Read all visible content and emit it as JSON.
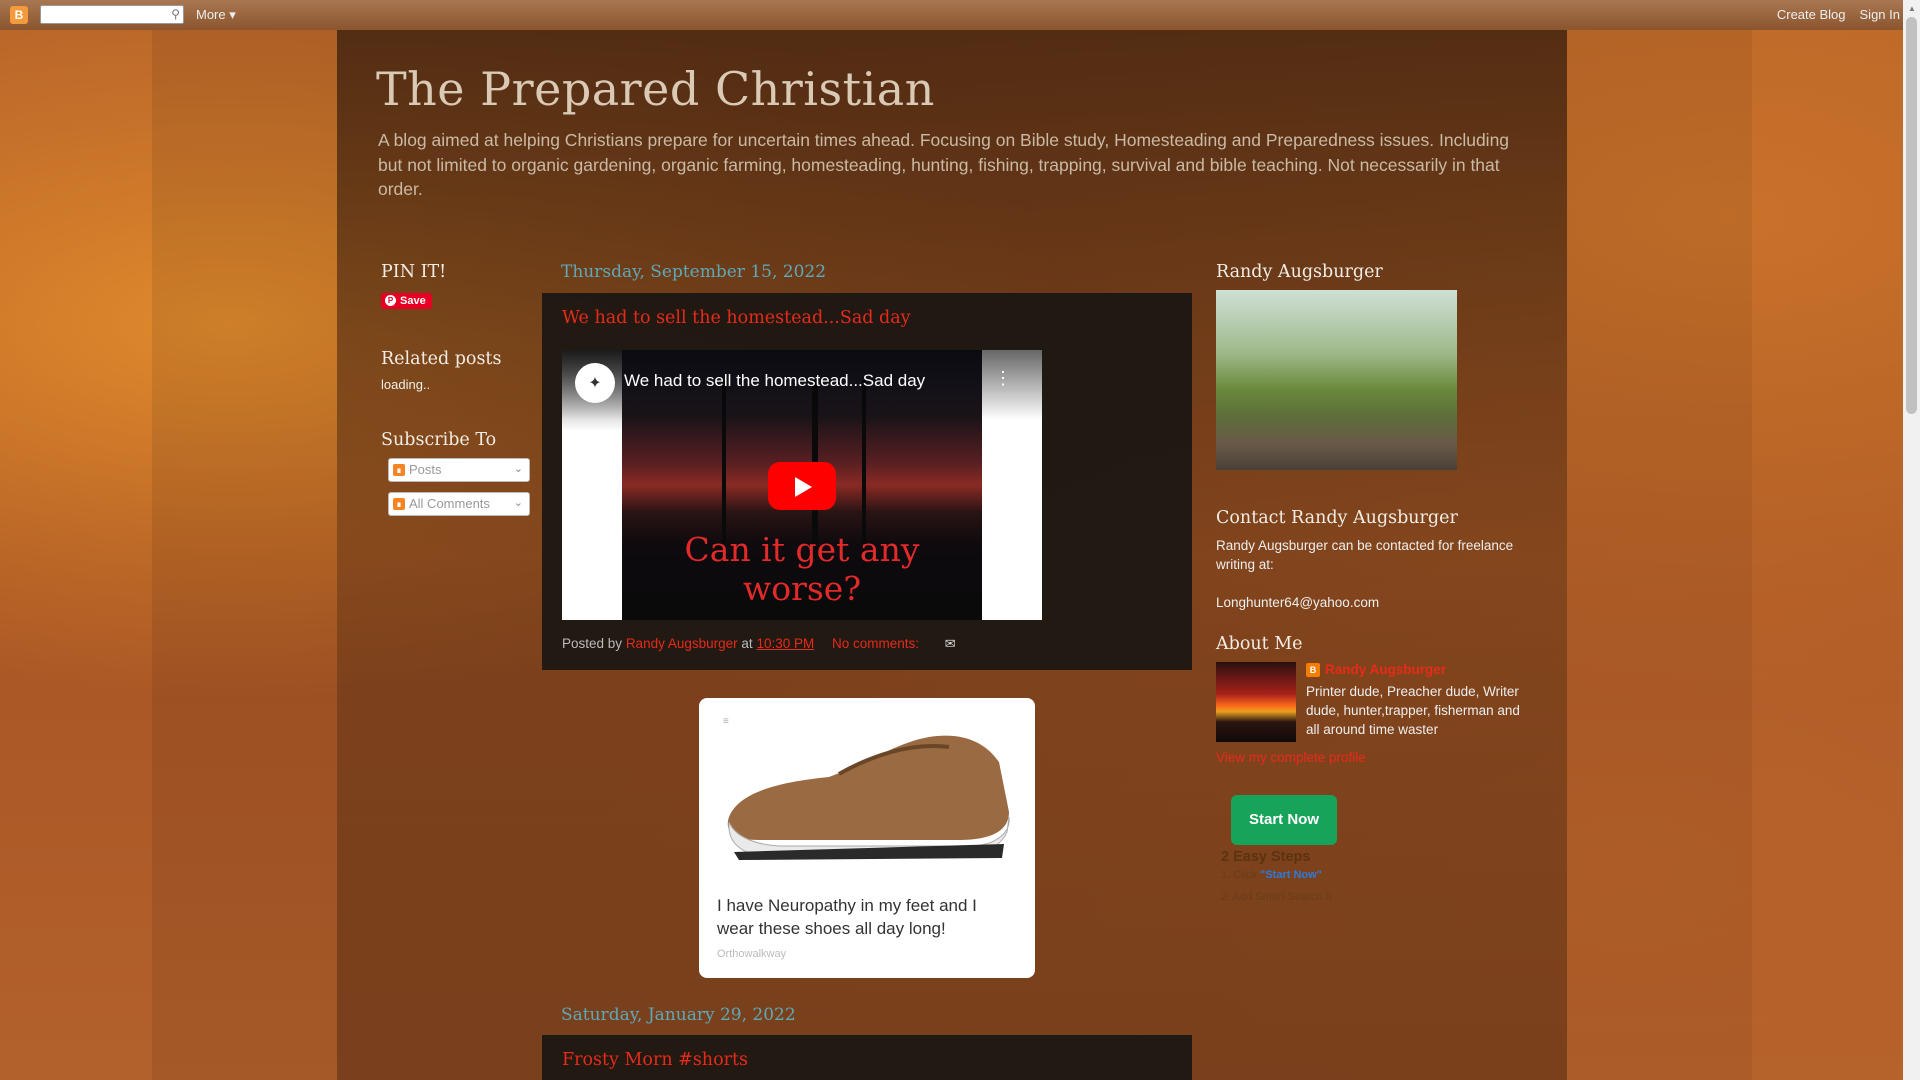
{
  "navbar": {
    "more_label": "More",
    "create_blog": "Create Blog",
    "sign_in": "Sign In"
  },
  "header": {
    "title": "The Prepared Christian",
    "description": "A blog aimed at helping Christians prepare for uncertain times ahead. Focusing on Bible study, Homesteading and Preparedness issues. Including but not limited to organic gardening, organic farming, homesteading, hunting, fishing, trapping, survival and bible teaching. Not necessarily in that order."
  },
  "left_sidebar": {
    "pin_title": "PIN IT!",
    "pin_button": "Save",
    "related_title": "Related posts",
    "related_loading": "loading..",
    "subscribe_title": "Subscribe To",
    "subscribe_posts": "Posts",
    "subscribe_comments": "All Comments"
  },
  "posts": [
    {
      "date": "Thursday, September 15, 2022",
      "title": "We had to sell the homestead...Sad day",
      "video_title": "We had to sell the homestead...Sad day",
      "video_caption": "Can it get any worse?",
      "posted_by_prefix": "Posted by",
      "author": "Randy Augsburger",
      "at": "at",
      "time": "10:30 PM",
      "comments": "No comments:"
    },
    {
      "date": "Saturday, January 29, 2022",
      "title": "Frosty Morn #shorts"
    }
  ],
  "ad": {
    "text": "I have Neuropathy in my feet and I wear these shoes all day long!",
    "brand": "Orthowalkway"
  },
  "right_sidebar": {
    "profile_title": "Randy Augsburger",
    "contact_title": "Contact Randy Augsburger",
    "contact_text": "Randy Augsburger can be contacted for freelance writing at:",
    "contact_email": "Longhunter64@yahoo.com",
    "about_title": "About Me",
    "about_name": "Randy Augsburger",
    "about_desc": "Printer dude, Preacher dude, Writer dude, hunter,trapper, fisherman and all around time waster",
    "view_profile": "View my complete profile",
    "start_button": "Start Now",
    "steps_title": "2 Easy Steps",
    "step1_prefix": "1. Click",
    "step1_highlight": "\"Start Now\"",
    "step2": "2. Add Smart Search b"
  },
  "colors": {
    "link_red": "#e62b1a",
    "date_teal": "#5fa8b8",
    "start_green": "#17a35a",
    "pinterest_red": "#e60023"
  }
}
